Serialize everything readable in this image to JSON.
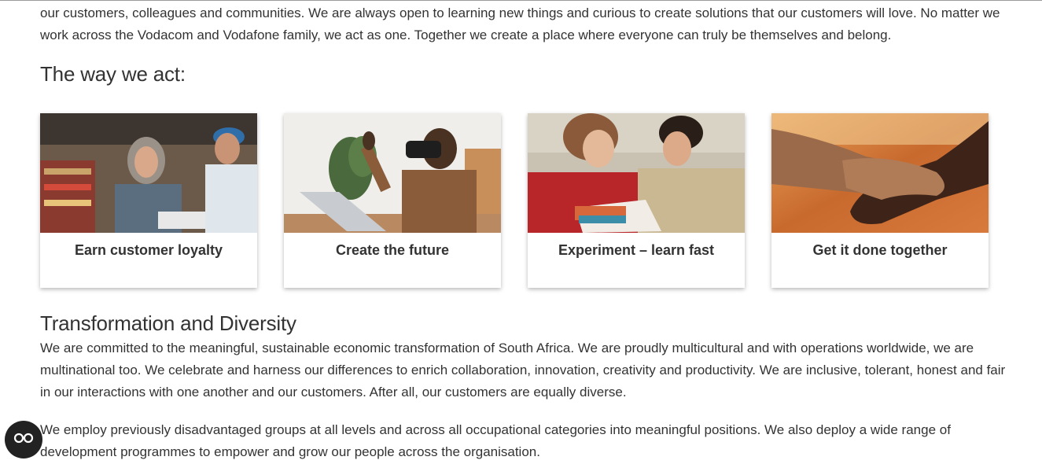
{
  "intro": {
    "text": "our customers, colleagues and communities. We are always open to learning new things and curious to create solutions that our customers will love. No matter we work across the Vodacom and Vodafone family, we act as one. Together we create a place where everyone can truly be themselves and belong."
  },
  "values_section": {
    "title": "The way we act:",
    "cards": [
      {
        "label": "Earn customer loyalty"
      },
      {
        "label": "Create the future"
      },
      {
        "label": "Experiment – learn fast"
      },
      {
        "label": "Get it done together"
      }
    ]
  },
  "transformation": {
    "title": "Transformation and Diversity",
    "paragraph1": "We are committed to the meaningful, sustainable economic transformation of South Africa. We are proudly multicultural and with operations worldwide, we are multinational too. We celebrate and harness our differences to enrich collaboration, innovation, creativity and productivity. We are inclusive, tolerant, honest and fair in our interactions with one another and our customers. After all, our customers are equally diverse.",
    "paragraph2": "We employ previously disadvantaged groups at all levels and across all occupational categories into meaningful positions. We also deploy a wide range of development programmes to empower and grow our people across the organisation."
  },
  "accessibility_button": {
    "icon": "accessibility-glasses-icon"
  }
}
